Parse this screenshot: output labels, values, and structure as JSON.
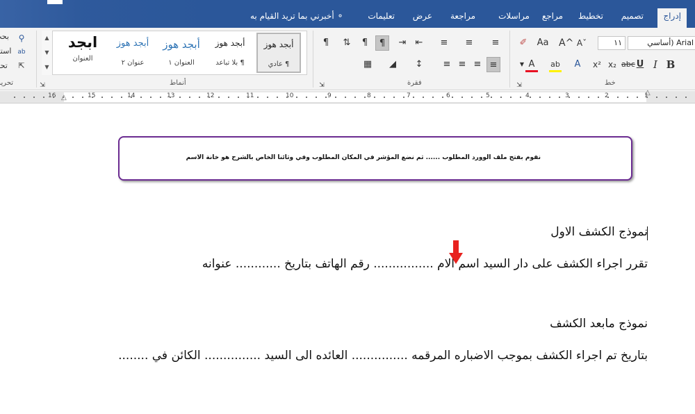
{
  "tabs": [
    {
      "label": "إدراج",
      "active": true
    },
    {
      "label": "تصميم"
    },
    {
      "label": "تخطيط"
    },
    {
      "label": "مراجع"
    },
    {
      "label": "مراسلات"
    },
    {
      "label": "مراجعة"
    },
    {
      "label": "عرض"
    },
    {
      "label": "تعليمات"
    }
  ],
  "tell_me": "أخبرني بما تريد القيام به",
  "ribbon": {
    "font_name": "Arial (أساسي",
    "font_size": "١١",
    "groups": {
      "font": "خط",
      "paragraph": "فقرة",
      "styles": "أنماط",
      "editing": "تحرير"
    },
    "editing": {
      "find": "بحث",
      "replace": "استب",
      "select": "تحديد"
    },
    "buttons": {
      "change_case": "Aa",
      "grow_font": "A^",
      "shrink_font": "Aˇ",
      "superscript": "x²",
      "subscript": "x₂",
      "strikethrough": "abc",
      "underline": "U",
      "italic": "I",
      "bold": "B",
      "font_color_letter": "A",
      "highlight_letter": "ab",
      "text_effects_letter": "A",
      "pilcrow": "¶"
    },
    "accent_colors": {
      "font_color": "#e81123",
      "highlight": "#fff200"
    },
    "styles": [
      {
        "preview": "أبجد هوز",
        "name": "¶ عادي",
        "selected": true
      },
      {
        "preview": "أبجد هوز",
        "name": "¶ بلا تباعد"
      },
      {
        "preview": "أبجد هوز",
        "name": "العنوان ١"
      },
      {
        "preview": "أبجد هوز",
        "name": "عنوان ٢"
      },
      {
        "preview": "ابجد",
        "name": "العنوان"
      }
    ]
  },
  "ruler": {
    "numbers": [
      "1",
      "2",
      "3",
      "4",
      "5",
      "6",
      "7",
      "8",
      "9",
      "10",
      "11",
      "12",
      "13",
      "14",
      "15",
      "16"
    ]
  },
  "document": {
    "callout_text": "نقوم بفتح ملف الوورد المطلوب ...... ثم نضع المؤشر في المكان المطلوب وفي وثائنا الخاص بالشرح هو خانة الاسم",
    "lines": [
      "نموذج الكشف الاول",
      "تقرر اجراء الكشف على دار السيد  اسم الام ................  رقم الهاتف  بتاريخ ............ عنوانه",
      "نموذج مابعد الكشف",
      "بتاريخ تم اجراء الكشف بموجب الاضباره المرقمه ............... العائده الى السيد ............... الكائن  في ........"
    ],
    "arrow_color": "#e8221f"
  }
}
